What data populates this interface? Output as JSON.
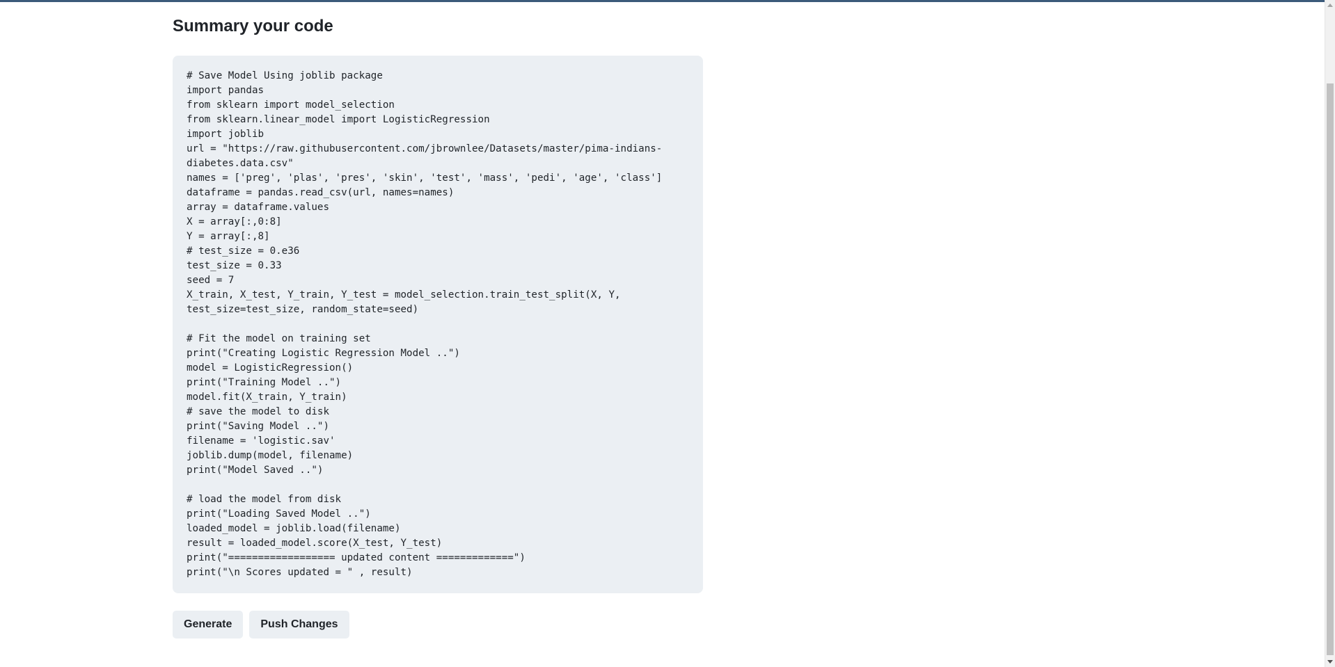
{
  "page": {
    "title": "Summary your code"
  },
  "code": {
    "text": "# Save Model Using joblib package\nimport pandas\nfrom sklearn import model_selection\nfrom sklearn.linear_model import LogisticRegression\nimport joblib\nurl = \"https://raw.githubusercontent.com/jbrownlee/Datasets/master/pima-indians-\ndiabetes.data.csv\"\nnames = ['preg', 'plas', 'pres', 'skin', 'test', 'mass', 'pedi', 'age', 'class']\ndataframe = pandas.read_csv(url, names=names)\narray = dataframe.values\nX = array[:,0:8]\nY = array[:,8]\n# test_size = 0.e36\ntest_size = 0.33\nseed = 7\nX_train, X_test, Y_train, Y_test = model_selection.train_test_split(X, Y,\ntest_size=test_size, random_state=seed)\n\n# Fit the model on training set\nprint(\"Creating Logistic Regression Model ..\")\nmodel = LogisticRegression()\nprint(\"Training Model ..\")\nmodel.fit(X_train, Y_train)\n# save the model to disk\nprint(\"Saving Model ..\")\nfilename = 'logistic.sav'\njoblib.dump(model, filename)\nprint(\"Model Saved ..\")\n\n# load the model from disk\nprint(\"Loading Saved Model ..\")\nloaded_model = joblib.load(filename)\nresult = loaded_model.score(X_test, Y_test)\nprint(\"================== updated content =============\")\nprint(\"\\n Scores updated = \" , result)"
  },
  "actions": {
    "generate_label": "Generate",
    "push_label": "Push Changes"
  },
  "colors": {
    "panel_bg": "#ebeff3",
    "top_border": "#3b5a7a",
    "text": "#1f2328"
  }
}
